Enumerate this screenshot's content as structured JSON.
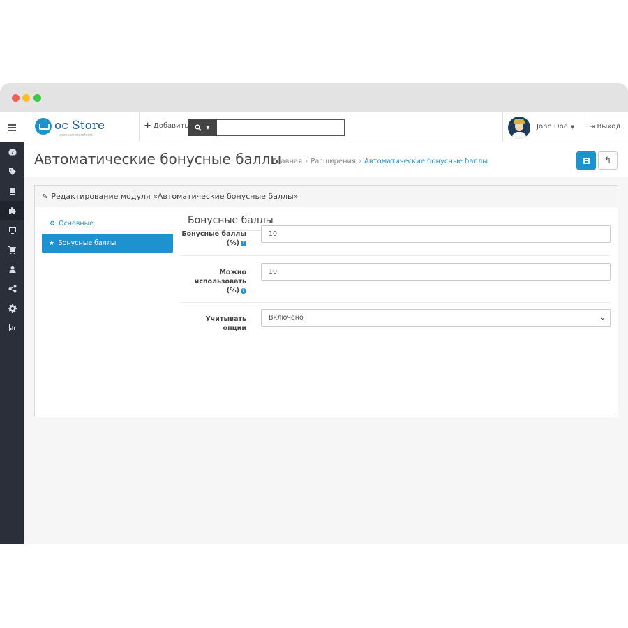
{
  "header": {
    "logo_brand": "oc Store",
    "logo_tagline": "opencart storefront",
    "add_label": "Добавить",
    "search_placeholder": "",
    "user_name": "John Doe",
    "logout_label": "Выход"
  },
  "sidebar": {
    "items": [
      {
        "icon": "dashboard-icon"
      },
      {
        "icon": "tags-icon"
      },
      {
        "icon": "book-icon"
      },
      {
        "icon": "puzzle-icon",
        "active": true
      },
      {
        "icon": "monitor-icon"
      },
      {
        "icon": "cart-icon"
      },
      {
        "icon": "user-icon"
      },
      {
        "icon": "share-icon"
      },
      {
        "icon": "cog-icon"
      },
      {
        "icon": "bar-chart-icon"
      }
    ]
  },
  "page": {
    "title": "Автоматические бонусные баллы",
    "breadcrumb": [
      "Главная",
      "Расширения",
      "Автоматические бонусные баллы"
    ]
  },
  "panel": {
    "title": "Редактирование модуля «Автоматические бонусные баллы»",
    "tabs": [
      {
        "label": "Основные",
        "icon": "gear-icon",
        "active": false
      },
      {
        "label": "Бонусные баллы",
        "icon": "star-icon",
        "active": true
      }
    ],
    "section_title": "Бонусные баллы",
    "fields": [
      {
        "label_line1": "Бонусные баллы",
        "label_line2": "(%)",
        "value": "10"
      },
      {
        "label_line1": "Можно",
        "label_line2": "использовать",
        "label_line3": "(%)",
        "value": "10"
      },
      {
        "label_line1": "Учитывать",
        "label_line2": "опции",
        "value": "Включено"
      }
    ]
  },
  "colors": {
    "accent": "#1e91cf",
    "sidebar_bg": "#2a2f3a"
  }
}
